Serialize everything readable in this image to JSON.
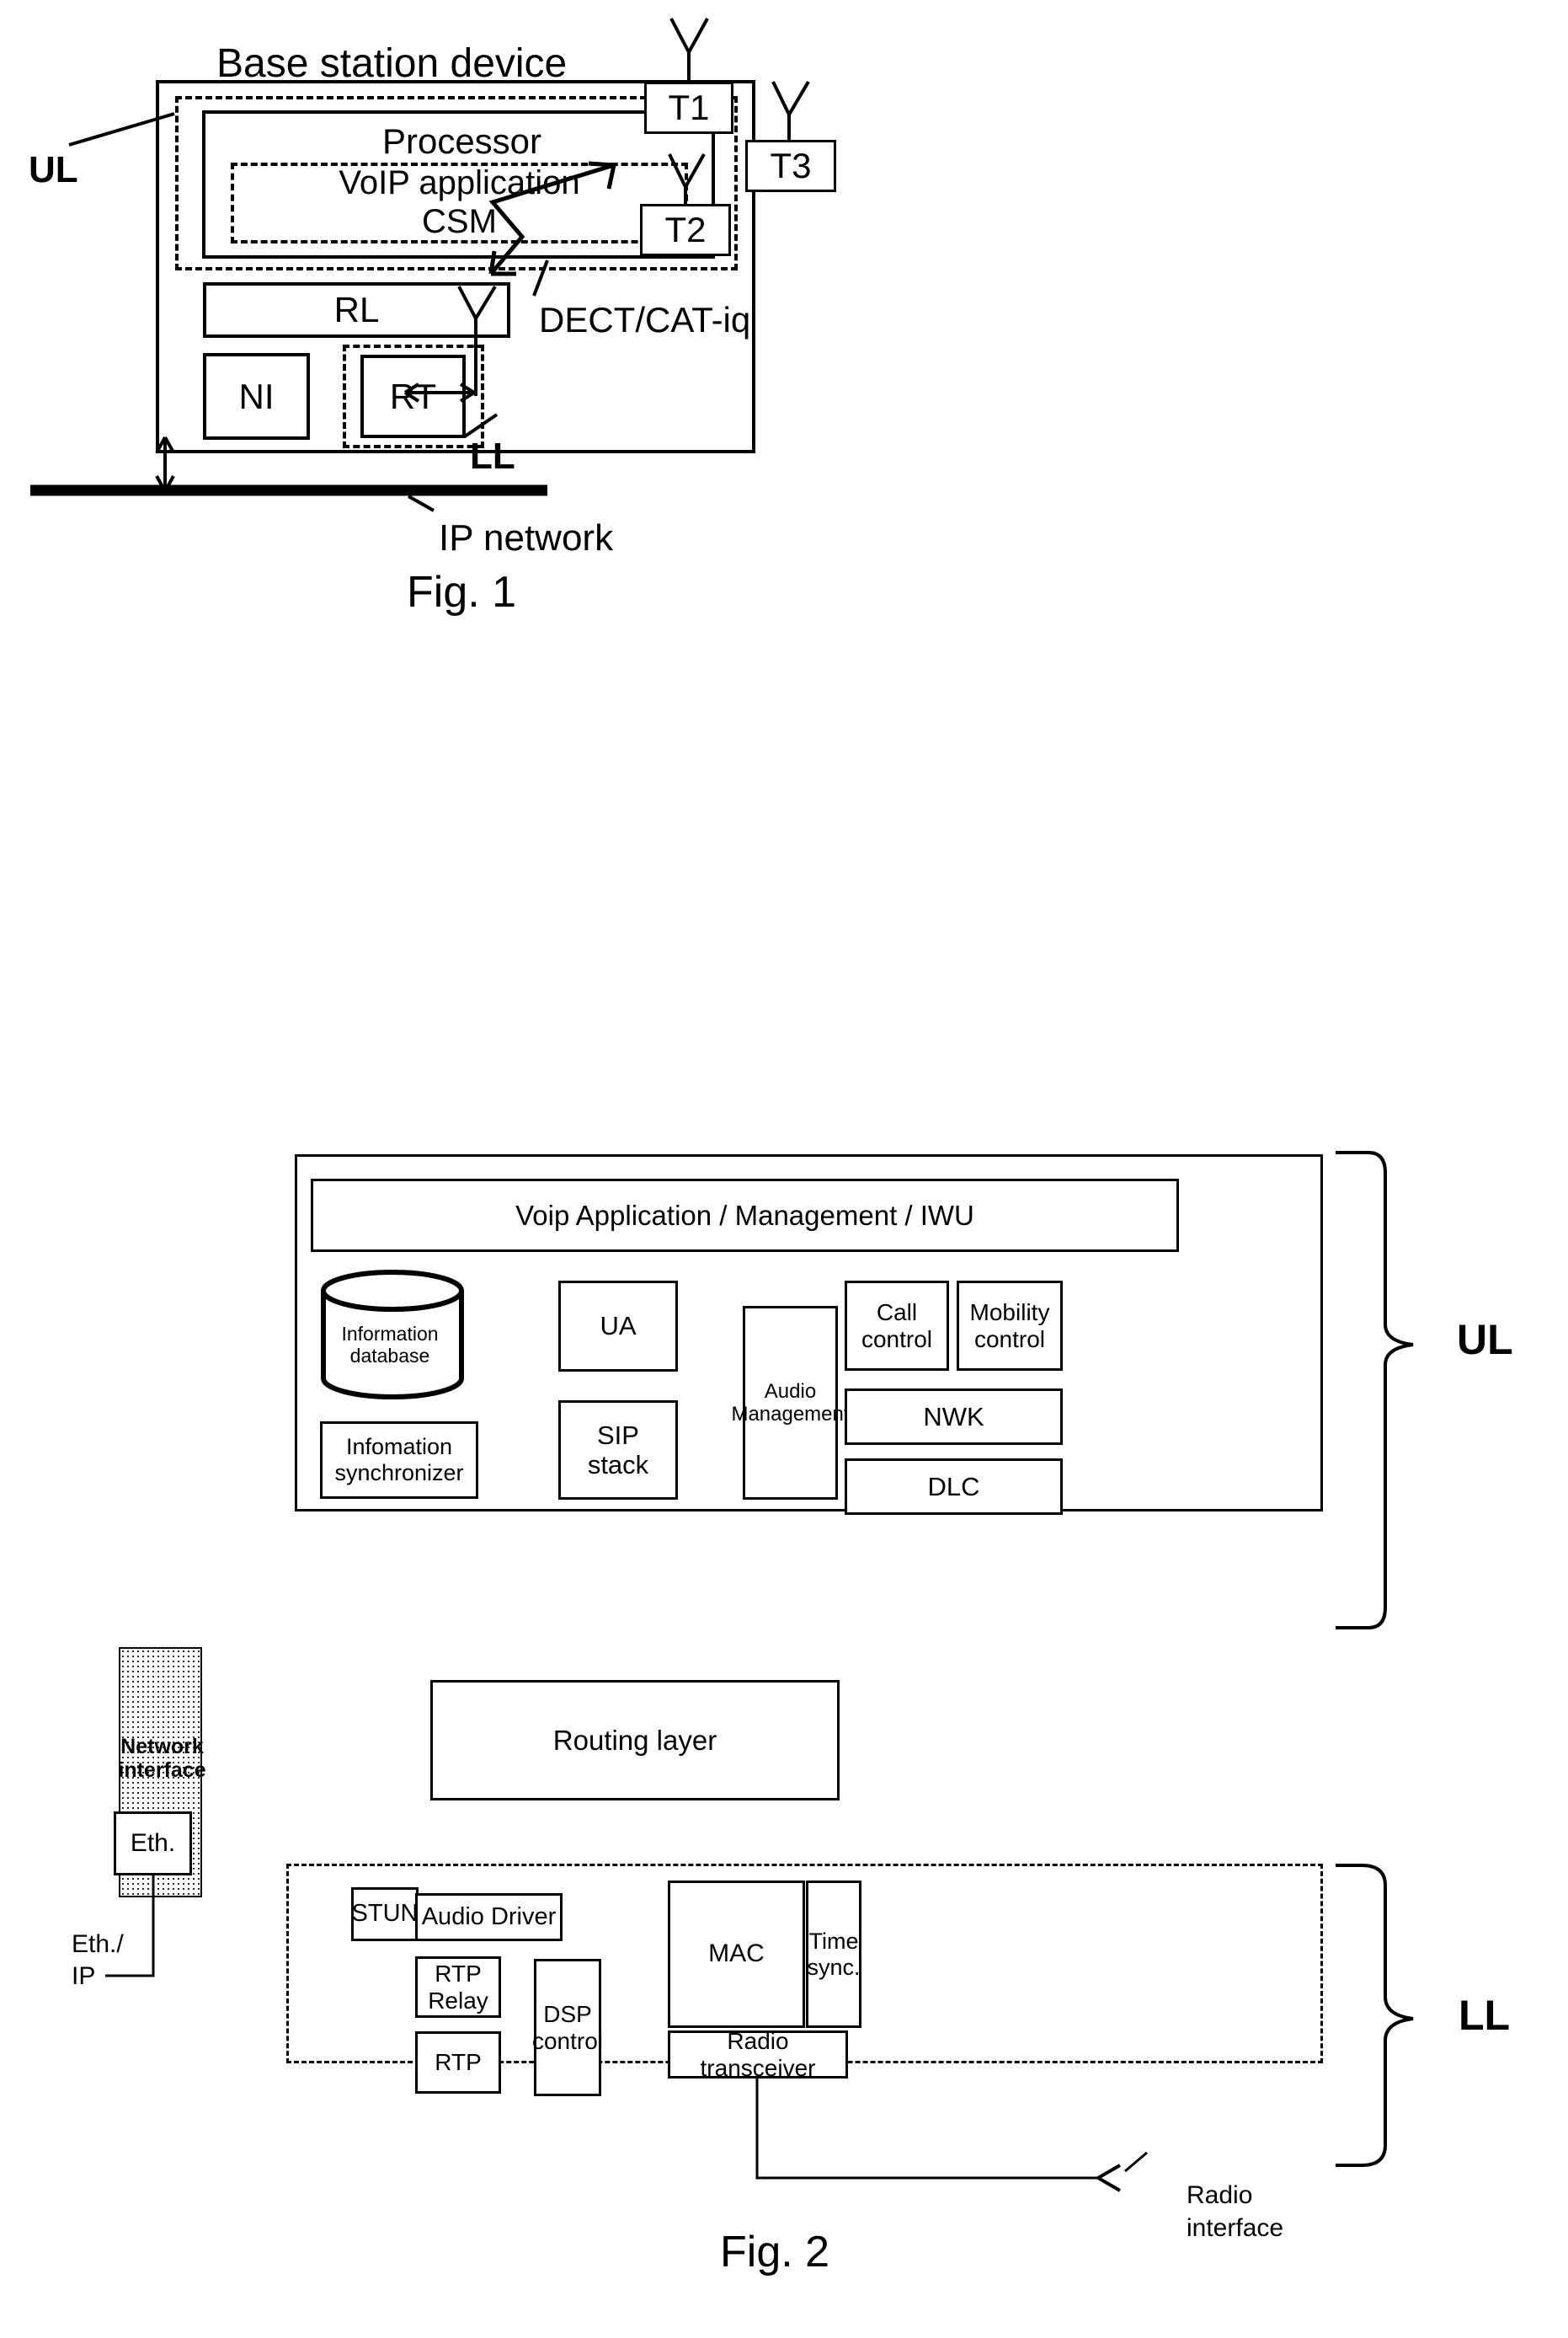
{
  "figure1": {
    "title": "Base station device",
    "caption": "Fig. 1",
    "blocks": {
      "processor": "Processor",
      "voip_app": "VoIP application\nCSM",
      "rl": "RL",
      "ni": "NI",
      "rt": "RT"
    },
    "layer_labels": {
      "ul": "UL",
      "ll": "LL"
    },
    "terminals": [
      "T1",
      "T2",
      "T3"
    ],
    "radio_link_label": "DECT/CAT-iq",
    "network_label": "IP network"
  },
  "figure2": {
    "caption": "Fig. 2",
    "upper_layer": {
      "header": "Voip  Application / Management / IWU",
      "database": "Information\ndatabase",
      "synchronizer": "Infomation\nsynchronizer",
      "ua": "UA",
      "sip_stack": "SIP\nstack",
      "audio_management": "Audio\nManagement",
      "call_control": "Call\ncontrol",
      "mobility_control": "Mobility\ncontrol",
      "nwk": "NWK",
      "dlc": "DLC"
    },
    "routing_layer": "Routing layer",
    "network_interface": {
      "title": "Network\ninterface",
      "eth": "Eth.",
      "link_label": "Eth./\nIP"
    },
    "lower_layer": {
      "stun": "STUN",
      "audio_driver": "Audio Driver",
      "rtp_relay": "RTP\nRelay",
      "rtp": "RTP",
      "dsp_control": "DSP\ncontrol",
      "mac": "MAC",
      "time_sync": "Time\nsync.",
      "radio_transceiver": "Radio transceiver"
    },
    "radio_interface_label": "Radio\ninterface",
    "brace_labels": {
      "ul": "UL",
      "ll": "LL"
    }
  }
}
